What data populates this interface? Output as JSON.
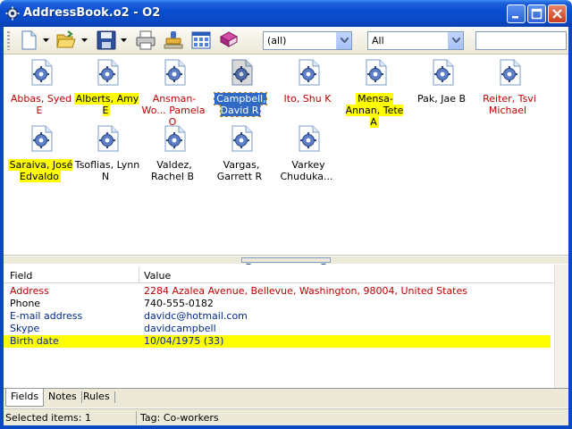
{
  "window": {
    "title": "AddressBook.o2 - O2"
  },
  "toolbar": {
    "buttons": [
      {
        "name": "new-contact",
        "icon": "new-document-icon"
      },
      {
        "name": "open",
        "icon": "open-folder-icon"
      },
      {
        "name": "save",
        "icon": "floppy-disk-icon"
      },
      {
        "name": "print",
        "icon": "printer-icon"
      },
      {
        "name": "stamp",
        "icon": "stamp-icon"
      },
      {
        "name": "view",
        "icon": "grid-view-icon"
      },
      {
        "name": "book",
        "icon": "book-icon"
      }
    ],
    "filter_combo_1": {
      "value": "(all)"
    },
    "filter_combo_2": {
      "value": "All"
    },
    "search": {
      "value": ""
    }
  },
  "contacts": [
    {
      "label": "Abbas, Syed E",
      "style": "red"
    },
    {
      "label": "Alberts, Amy E",
      "style": "highlight"
    },
    {
      "label": "Ansman-Wo... Pamela O",
      "style": "red"
    },
    {
      "label": "Campbell, David R",
      "style": "selected"
    },
    {
      "label": "Ito, Shu K",
      "style": "red"
    },
    {
      "label": "Mensa-Annan, Tete A",
      "style": "highlight"
    },
    {
      "label": "Pak, Jae B",
      "style": "normal"
    },
    {
      "label": "Reiter, Tsvi Michael",
      "style": "red"
    },
    {
      "label": "Saraiva, José Edvaldo",
      "style": "highlight"
    },
    {
      "label": "Tsoflias, Lynn N",
      "style": "normal"
    },
    {
      "label": "Valdez, Rachel B",
      "style": "normal"
    },
    {
      "label": "Vargas, Garrett R",
      "style": "normal"
    },
    {
      "label": "Varkey Chuduka...",
      "style": "normal"
    }
  ],
  "details": {
    "columns": {
      "field": "Field",
      "value": "Value"
    },
    "rows": [
      {
        "field": "Address",
        "value": "2284 Azalea Avenue, Bellevue, Washington, 98004, United States",
        "color": "#c00000"
      },
      {
        "field": "Phone",
        "value": "740-555-0182",
        "color": "#000000"
      },
      {
        "field": "E-mail address",
        "value": "davidc@hotmail.com",
        "color": "#002a8c"
      },
      {
        "field": "Skype",
        "value": "davidcampbell",
        "color": "#002a8c"
      },
      {
        "field": "Birth date",
        "value": "10/04/1975 (33)",
        "color": "#002a8c",
        "highlight": true
      }
    ]
  },
  "tabs": [
    {
      "label": "Fields",
      "active": true
    },
    {
      "label": "Notes",
      "active": false
    },
    {
      "label": "Rules",
      "active": false
    }
  ],
  "status": {
    "selected": "Selected items: 1",
    "tag": "Tag: Co-workers"
  },
  "colors": {
    "titlebar": "#0a48c4",
    "highlight": "#ffff00",
    "selection": "#316ac5",
    "red_text": "#c00000"
  }
}
